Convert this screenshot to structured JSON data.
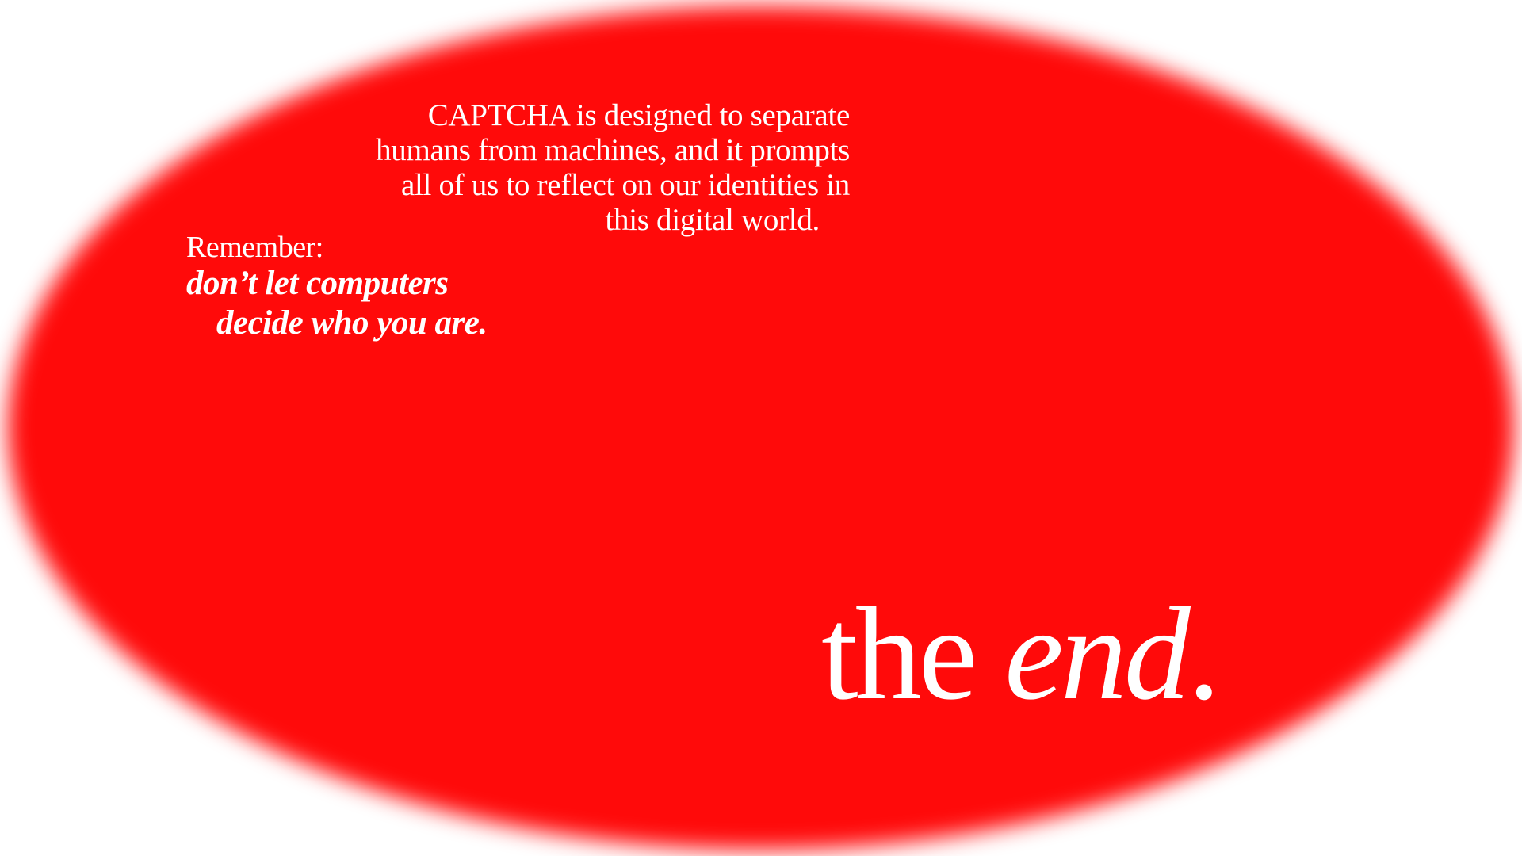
{
  "colors": {
    "background": "#ffffff",
    "ellipse": "#ff0a0a",
    "text": "#ffffff"
  },
  "paragraph": {
    "lines": [
      "CAPTCHA is designed to separate",
      "humans from machines, and it prompts",
      "all of us to reflect on our identities in",
      "this digital world."
    ]
  },
  "reminder": {
    "label": "Remember:",
    "lines": [
      "don’t let computers",
      "decide who you are."
    ]
  },
  "closing": {
    "prefix": "the ",
    "emphasis": "end",
    "suffix": "."
  }
}
